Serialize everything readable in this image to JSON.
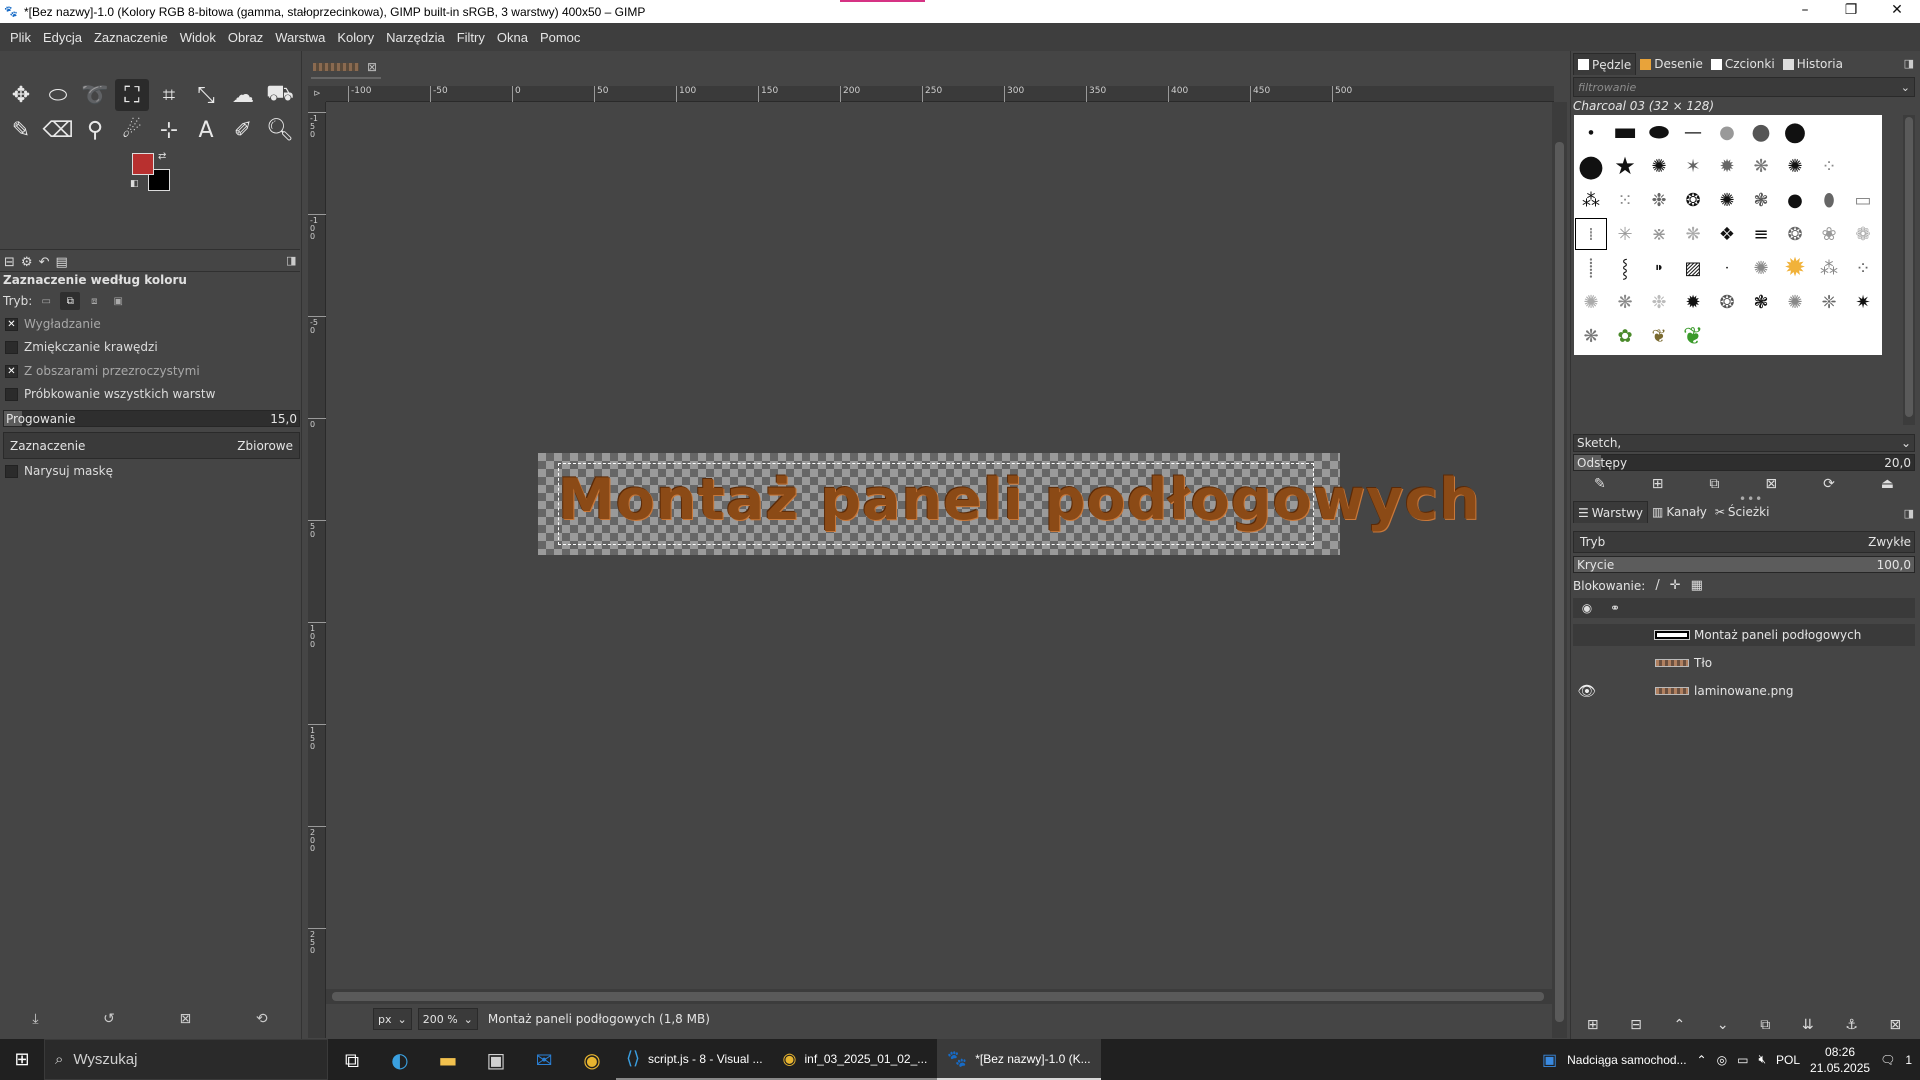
{
  "window": {
    "title": "*[Bez nazwy]-1.0 (Kolory RGB 8-bitowa (gamma, stałoprzecinkowa), GIMP built-in sRGB, 3 warstwy) 400x50 – GIMP",
    "min": "–",
    "max": "❐",
    "close": "✕"
  },
  "menu": [
    "Plik",
    "Edycja",
    "Zaznaczenie",
    "Widok",
    "Obraz",
    "Warstwa",
    "Kolory",
    "Narzędzia",
    "Filtry",
    "Okna",
    "Pomoc"
  ],
  "tool_options": {
    "title": "Zaznaczenie według koloru",
    "mode_label": "Tryb:",
    "antialias": "Wygładzanie",
    "feather": "Zmiękczanie krawędzi",
    "transparent": "Z obszarami przezroczystymi",
    "sample_merged": "Próbkowanie wszystkich warstw",
    "threshold_label": "Progowanie",
    "threshold_value": "15,0",
    "threshold_fraction": 0.06,
    "select_by_label": "Zaznaczenie",
    "select_by_value": "Zbiorowe",
    "draw_mask": "Narysuj maskę"
  },
  "canvas": {
    "ruler_h": [
      "-100",
      "-50",
      "0",
      "50",
      "100",
      "150",
      "200",
      "250",
      "300",
      "350",
      "400",
      "450",
      "500"
    ],
    "ruler_v": [
      "-150",
      "-100",
      "-50",
      "0",
      "50",
      "100",
      "150",
      "200",
      "250"
    ],
    "image_text": "Montaż paneli podłogowych",
    "unit": "px",
    "zoom": "200 %",
    "status": "Montaż paneli podłogowych (1,8 MB)"
  },
  "right_dock": {
    "tabs": [
      "Pędzle",
      "Desenie",
      "Czcionki",
      "Historia"
    ],
    "filter_placeholder": "filtrowanie",
    "brush_name": "Charcoal 03 (32 × 128)",
    "preset": "Sketch,",
    "spacing_label": "Odstępy",
    "spacing_value": "20,0",
    "spacing_fraction": 0.08,
    "layer_tabs": [
      "Warstwy",
      "Kanały",
      "Ścieżki"
    ],
    "mode_label": "Tryb",
    "mode_value": "Zwykłe",
    "opacity_label": "Krycie",
    "opacity_value": "100,0",
    "opacity_fraction": 1.0,
    "lock_label": "Blokowanie:",
    "layers": [
      {
        "name": "Montaż paneli podłogowych",
        "visible": false,
        "thumb": "white"
      },
      {
        "name": "Tło",
        "visible": false,
        "thumb": "tex"
      },
      {
        "name": "laminowane.png",
        "visible": true,
        "thumb": "tex"
      }
    ]
  },
  "taskbar": {
    "search": "Wyszukaj",
    "apps": [
      "script.js - 8 - Visual ...",
      "inf_03_2025_01_02_...",
      "*[Bez nazwy]-1.0 (K..."
    ],
    "weather": "Nadciąga samochod...",
    "lang": "POL",
    "time": "08:26",
    "date": "21.05.2025",
    "notif_count": "1"
  }
}
